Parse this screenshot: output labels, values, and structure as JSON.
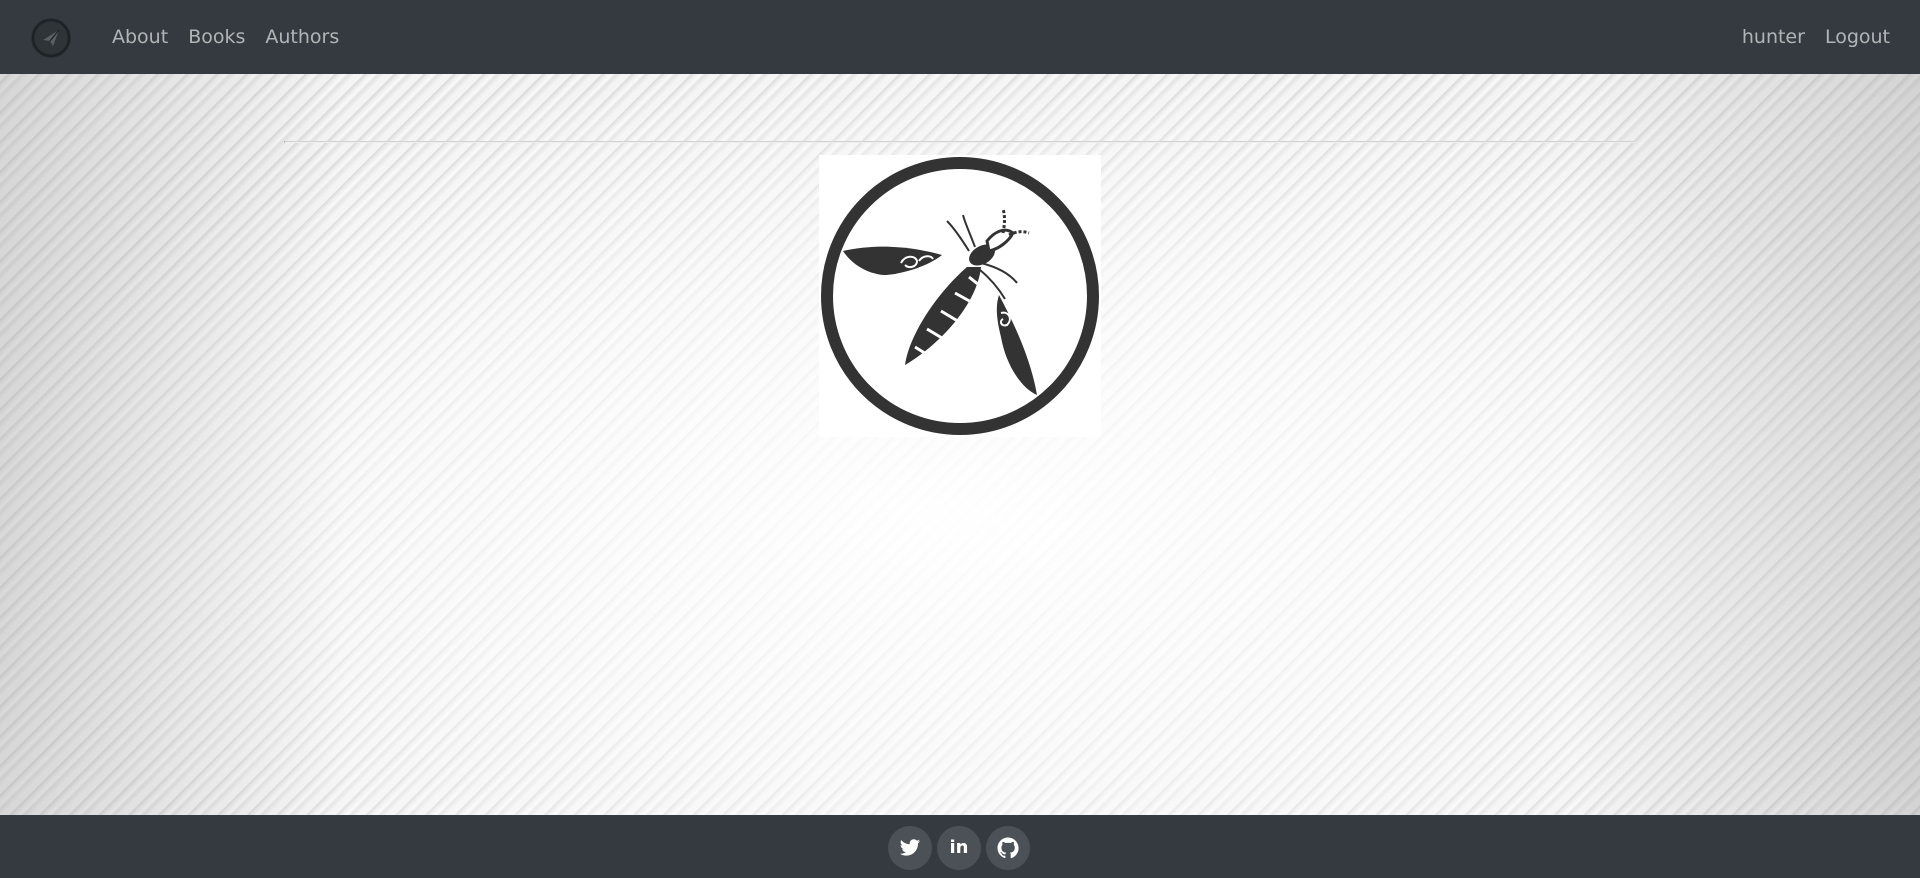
{
  "navbar": {
    "brand_icon": "paper-plane-logo-icon",
    "links": [
      {
        "label": "About"
      },
      {
        "label": "Books"
      },
      {
        "label": "Authors"
      }
    ],
    "user": {
      "label": "hunter"
    },
    "logout": {
      "label": "Logout"
    },
    "colors": {
      "background": "#343a40",
      "link": "#a3a6a9"
    }
  },
  "main": {
    "logo_image": "owasp-wasp-logo",
    "background": "grey-diagonal-streaks"
  },
  "footer": {
    "social": [
      {
        "icon": "twitter-icon"
      },
      {
        "icon": "linkedin-icon",
        "glyph": "in"
      },
      {
        "icon": "github-icon"
      }
    ],
    "colors": {
      "background": "#343a40",
      "button": "#4b5157"
    }
  }
}
